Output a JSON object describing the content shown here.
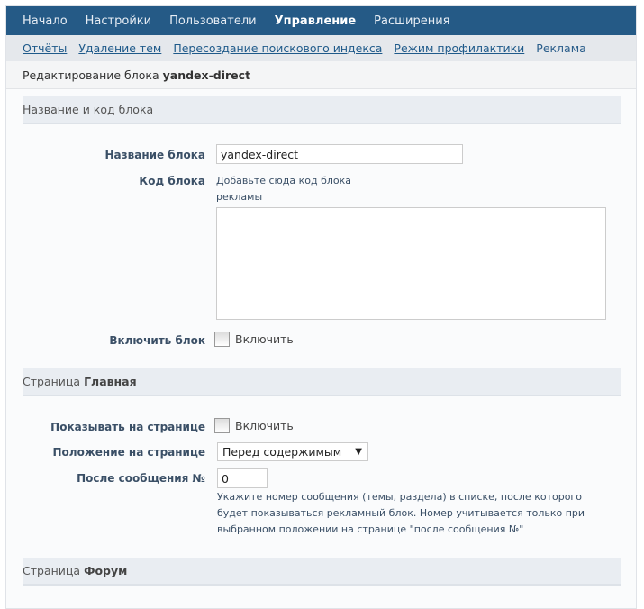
{
  "nav": {
    "items": [
      "Начало",
      "Настройки",
      "Пользователи",
      "Управление",
      "Расширения"
    ],
    "active": 3
  },
  "subnav": {
    "items": [
      "Отчёты",
      "Удаление тем",
      "Пересоздание поискового индекса",
      "Режим профилактики",
      "Реклама"
    ]
  },
  "title": {
    "prefix": "Редактирование блока",
    "name": "yandex-direct"
  },
  "section1": {
    "title": "Название и код блока",
    "name_label": "Название блока",
    "name_value": "yandex-direct",
    "code_label": "Код блока",
    "code_hint": "Добавьте сюда код блока рекламы",
    "code_value": "",
    "enable_label": "Включить блок",
    "enable_checkbox": "Включить"
  },
  "section2": {
    "prefix": "Страница",
    "name": "Главная",
    "show_label": "Показывать на странице",
    "show_checkbox": "Включить",
    "position_label": "Положение на странице",
    "position_value": "Перед содержимым",
    "after_label": "После сообщения №",
    "after_value": "0",
    "after_hint": "Укажите номер сообщения (темы, раздела) в списке, после которого будет показываться рекламный блок. Номер учитывается только при выбранном положении на странице \"после сообщения №\""
  },
  "section3": {
    "prefix": "Страница",
    "name": "Форум"
  }
}
